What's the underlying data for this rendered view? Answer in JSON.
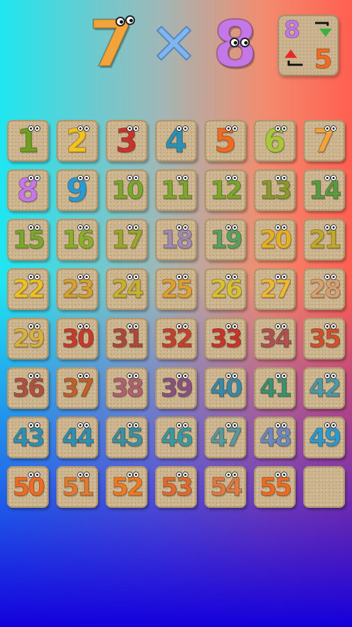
{
  "problem": {
    "left_factor": "7",
    "operator_icon": "times-icon",
    "right_factor": "8",
    "left_color": "#f2a33a",
    "right_color": "#c577e8"
  },
  "swap_button": {
    "top_number": "8",
    "bottom_number": "5",
    "icon_up": "red-up-triangle",
    "icon_down": "green-down-triangle"
  },
  "answers": {
    "tiles": [
      {
        "label": "1",
        "color": "#6f9f1e"
      },
      {
        "label": "2",
        "color": "#f4c21c"
      },
      {
        "label": "3",
        "color": "#c8342c"
      },
      {
        "label": "4",
        "color": "#2f8fb3"
      },
      {
        "label": "5",
        "color": "#f06a21"
      },
      {
        "label": "6",
        "color": "#a8c83a"
      },
      {
        "label": "7",
        "color": "#f2a33a"
      },
      {
        "label": "8",
        "color": "#c577e8"
      },
      {
        "label": "9",
        "color": "#2a9ad0"
      },
      {
        "label": "10",
        "color": "#7aa82a"
      },
      {
        "label": "11",
        "color": "#7aa82a"
      },
      {
        "label": "12",
        "color": "#7aa82a"
      },
      {
        "label": "13",
        "color": "#8a9a2a"
      },
      {
        "label": "14",
        "color": "#5a9a40"
      },
      {
        "label": "15",
        "color": "#7aa82a"
      },
      {
        "label": "16",
        "color": "#8ab02a"
      },
      {
        "label": "17",
        "color": "#9aa82a"
      },
      {
        "label": "18",
        "color": "#a08ab0"
      },
      {
        "label": "19",
        "color": "#5aa060"
      },
      {
        "label": "20",
        "color": "#e6b020"
      },
      {
        "label": "21",
        "color": "#c0a82a"
      },
      {
        "label": "22",
        "color": "#f0c020"
      },
      {
        "label": "23",
        "color": "#d8a030"
      },
      {
        "label": "24",
        "color": "#c8b030"
      },
      {
        "label": "25",
        "color": "#e0a030"
      },
      {
        "label": "26",
        "color": "#d8c030"
      },
      {
        "label": "27",
        "color": "#f0b830"
      },
      {
        "label": "28",
        "color": "#d8a070"
      },
      {
        "label": "29",
        "color": "#d8b040"
      },
      {
        "label": "30",
        "color": "#c83a2c"
      },
      {
        "label": "31",
        "color": "#b0483a"
      },
      {
        "label": "32",
        "color": "#c8402c"
      },
      {
        "label": "33",
        "color": "#c8342c"
      },
      {
        "label": "34",
        "color": "#b05050"
      },
      {
        "label": "35",
        "color": "#d0502c"
      },
      {
        "label": "36",
        "color": "#b05040"
      },
      {
        "label": "37",
        "color": "#c0602c"
      },
      {
        "label": "38",
        "color": "#b06070"
      },
      {
        "label": "39",
        "color": "#8a5080"
      },
      {
        "label": "40",
        "color": "#3a88a8"
      },
      {
        "label": "41",
        "color": "#3a9070"
      },
      {
        "label": "42",
        "color": "#4a98a8"
      },
      {
        "label": "43",
        "color": "#2f8fb3"
      },
      {
        "label": "44",
        "color": "#2f8fb3"
      },
      {
        "label": "45",
        "color": "#3a90a0"
      },
      {
        "label": "46",
        "color": "#3a98a0"
      },
      {
        "label": "47",
        "color": "#5a98a0"
      },
      {
        "label": "48",
        "color": "#6a88c0"
      },
      {
        "label": "49",
        "color": "#2a9ad0"
      },
      {
        "label": "50",
        "color": "#f06a21"
      },
      {
        "label": "51",
        "color": "#e07a30"
      },
      {
        "label": "52",
        "color": "#f07a21"
      },
      {
        "label": "53",
        "color": "#e06a30"
      },
      {
        "label": "54",
        "color": "#e07a40"
      },
      {
        "label": "55",
        "color": "#f06a21"
      },
      {
        "label": "",
        "color": ""
      }
    ]
  }
}
